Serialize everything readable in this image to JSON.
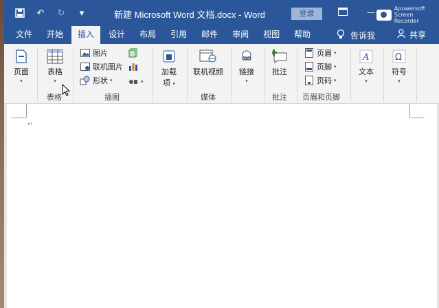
{
  "titlebar": {
    "title": "新建 Microsoft Word 文档.docx  -  Word",
    "login": "登录",
    "qat_icons": [
      "save-icon",
      "undo-icon",
      "redo-icon",
      "customize-icon"
    ],
    "recorder_line1": "Apowersoft",
    "recorder_line2": "Screen Recorder"
  },
  "tabs": {
    "items": [
      "文件",
      "开始",
      "插入",
      "设计",
      "布局",
      "引用",
      "邮件",
      "审阅",
      "视图",
      "帮助"
    ],
    "active": "插入",
    "tell_me": "告诉我",
    "share": "共享"
  },
  "ribbon": {
    "pages_label": "页面",
    "table_label": "表格",
    "table_group": "表格",
    "picture": "图片",
    "online_picture": "联机图片",
    "shapes": "形状",
    "illustrations_group": "插图",
    "addins_line1": "加载",
    "addins_line2": "项",
    "online_video": "联机视频",
    "media_group": "媒体",
    "link": "链接",
    "comment": "批注",
    "comment_group": "批注",
    "header": "页眉",
    "footer": "页脚",
    "page_number": "页码",
    "header_footer_group": "页眉和页脚",
    "text": "文本",
    "symbol": "符号",
    "caret": "▾"
  },
  "document": {
    "paragraph_mark": "↵"
  },
  "colors": {
    "brand": "#2b579a",
    "ribbon_bg": "#f3f3f3"
  }
}
